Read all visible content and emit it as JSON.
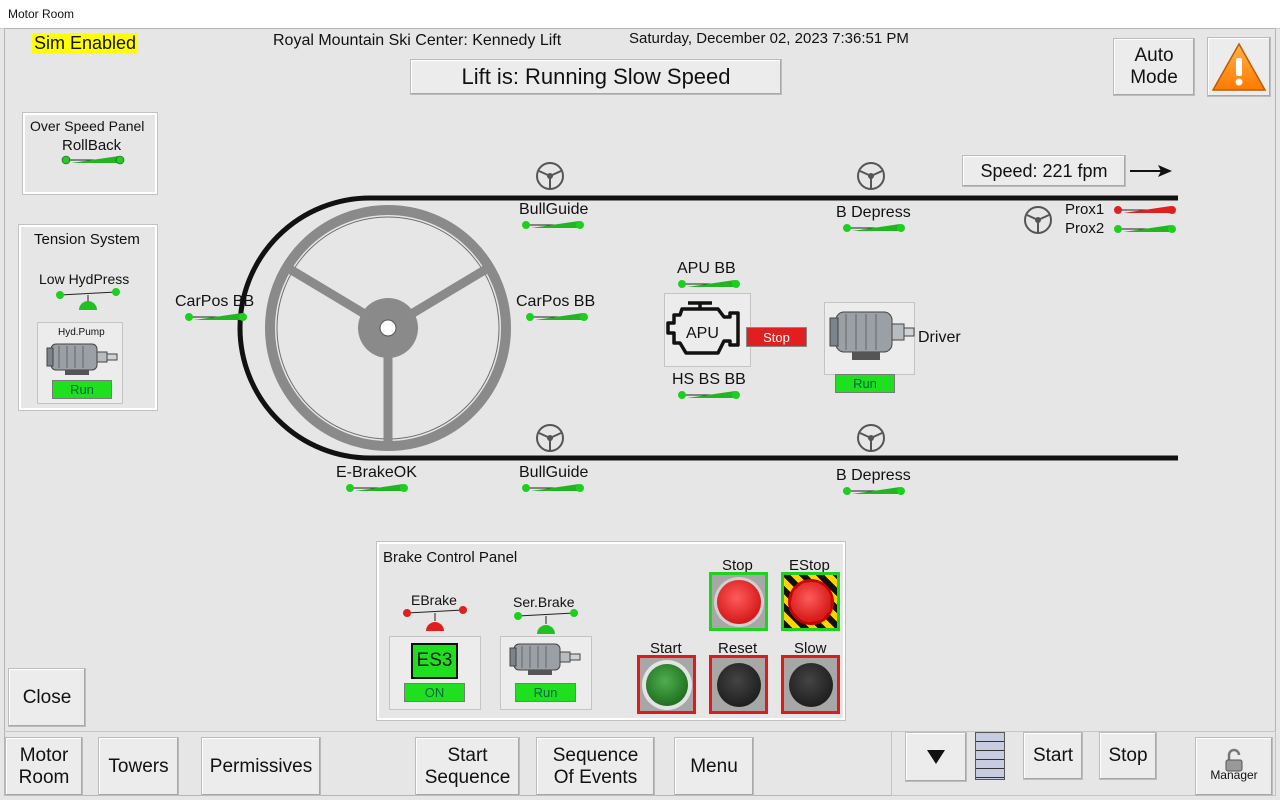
{
  "window": {
    "title": "Motor Room"
  },
  "header": {
    "sim_status": "Sim Enabled",
    "site": "Royal Mountain Ski Center: Kennedy Lift",
    "datetime": "Saturday, December 02, 2023 7:36:51 PM",
    "lift_status": "Lift is: Running Slow Speed",
    "mode_line1": "Auto",
    "mode_line2": "Mode"
  },
  "overspeed": {
    "title": "Over Speed Panel",
    "item": "RollBack"
  },
  "tension": {
    "title": "Tension System",
    "low_hydpress": "Low HydPress",
    "pump_label": "Hyd.Pump",
    "pump_status": "Run"
  },
  "track": {
    "speed": "Speed: 221 fpm",
    "carpos_left": "CarPos BB",
    "carpos_right": "CarPos BB",
    "bullguide_top": "BullGuide",
    "bullguide_bottom": "BullGuide",
    "bdepress_top": "B Depress",
    "bdepress_bottom": "B Depress",
    "ebrake_ok": "E-BrakeOK",
    "prox1": "Prox1",
    "prox2": "Prox2"
  },
  "apu": {
    "label": "APU",
    "apu_bb": "APU  BB",
    "hs_bs_bb": "HS BS BB",
    "status": "Stop"
  },
  "driver": {
    "label": "Driver",
    "status": "Run"
  },
  "brake_panel": {
    "title": "Brake Control Panel",
    "ebrake": "EBrake",
    "ser_brake": "Ser.Brake",
    "es3": "ES3",
    "es3_status": "ON",
    "ser_status": "Run",
    "stop": "Stop",
    "estop": "EStop",
    "start": "Start",
    "reset": "Reset",
    "slow": "Slow"
  },
  "close_label": "Close",
  "nav": {
    "motor_room_1": "Motor",
    "motor_room_2": "Room",
    "towers": "Towers",
    "permissives": "Permissives",
    "start_seq_1": "Start",
    "start_seq_2": "Sequence",
    "soe_1": "Sequence",
    "soe_2": "Of Events",
    "menu": "Menu",
    "start": "Start",
    "stop": "Stop",
    "manager": "Manager"
  },
  "icons": {
    "warning": "warning-triangle-icon",
    "arrow": "right-arrow-icon",
    "wheel": "steering-wheel-icon",
    "motor": "electric-motor-icon",
    "engine": "engine-icon",
    "down": "down-triangle-icon",
    "lock": "padlock-icon"
  },
  "colors": {
    "green": "#1fe01f",
    "red": "#e02020",
    "sim_yellow": "#ffff00",
    "warning_orange": "#ff8c00"
  }
}
